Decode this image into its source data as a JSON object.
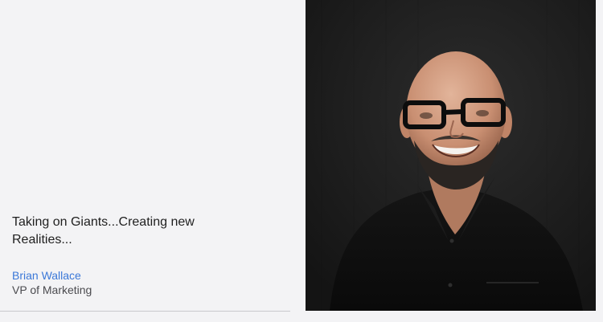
{
  "testimonial": {
    "quote": "Taking on Giants...Creating new Realities...",
    "author_name": "Brian Wallace",
    "author_title": "VP of Marketing"
  },
  "photo": {
    "subject": "portrait-of-smiling-bald-man-with-glasses-and-beard-in-black-shirt"
  },
  "colors": {
    "background": "#f3f3f5",
    "link": "#3b78d8",
    "photo_backdrop": "#1e1e1e"
  }
}
